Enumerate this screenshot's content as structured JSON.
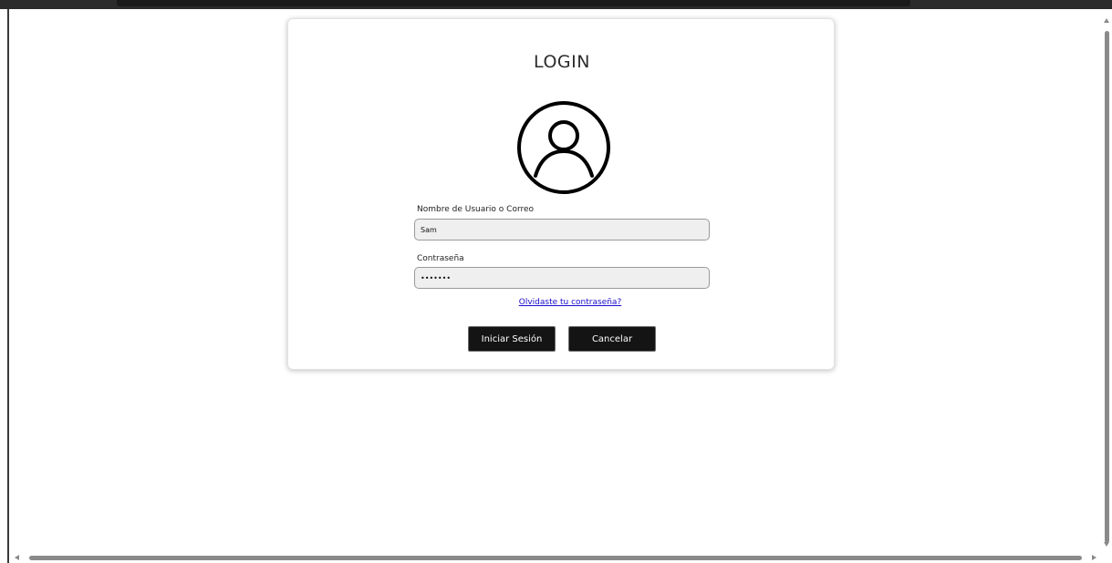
{
  "login": {
    "title": "LOGIN",
    "username": {
      "label": "Nombre de Usuario o Correo",
      "value": "Sam"
    },
    "password": {
      "label": "Contraseña",
      "value": "•••••••"
    },
    "forgot_link": "Olvidaste tu contraseña?",
    "buttons": {
      "login": "Iniciar Sesión",
      "cancel": "Cancelar"
    }
  },
  "icons": {
    "avatar": "user-circle-icon"
  },
  "colors": {
    "button_bg": "#141414",
    "link": "#1a0dcc",
    "input_bg": "#efefef"
  }
}
